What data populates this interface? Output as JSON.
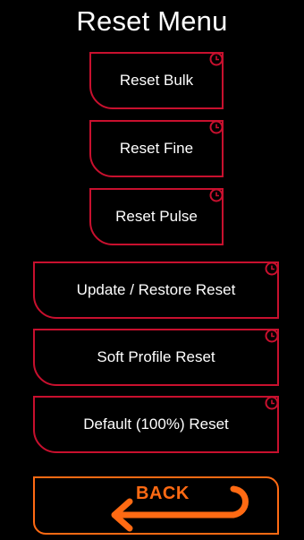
{
  "screen": {
    "title": "Reset Menu"
  },
  "buttons": {
    "reset_bulk": "Reset Bulk",
    "reset_fine": "Reset Fine",
    "reset_pulse": "Reset Pulse",
    "update_restore_reset": "Update / Restore Reset",
    "soft_profile_reset": "Soft Profile Reset",
    "default_reset": "Default (100%) Reset",
    "back": "BACK"
  },
  "colors": {
    "background": "#000000",
    "button_border": "#c8102e",
    "back_accent": "#ff6a13",
    "text": "#ffffff"
  },
  "icons": {
    "button_badge": "clock-icon",
    "back_arrow": "back-arrow-icon"
  }
}
